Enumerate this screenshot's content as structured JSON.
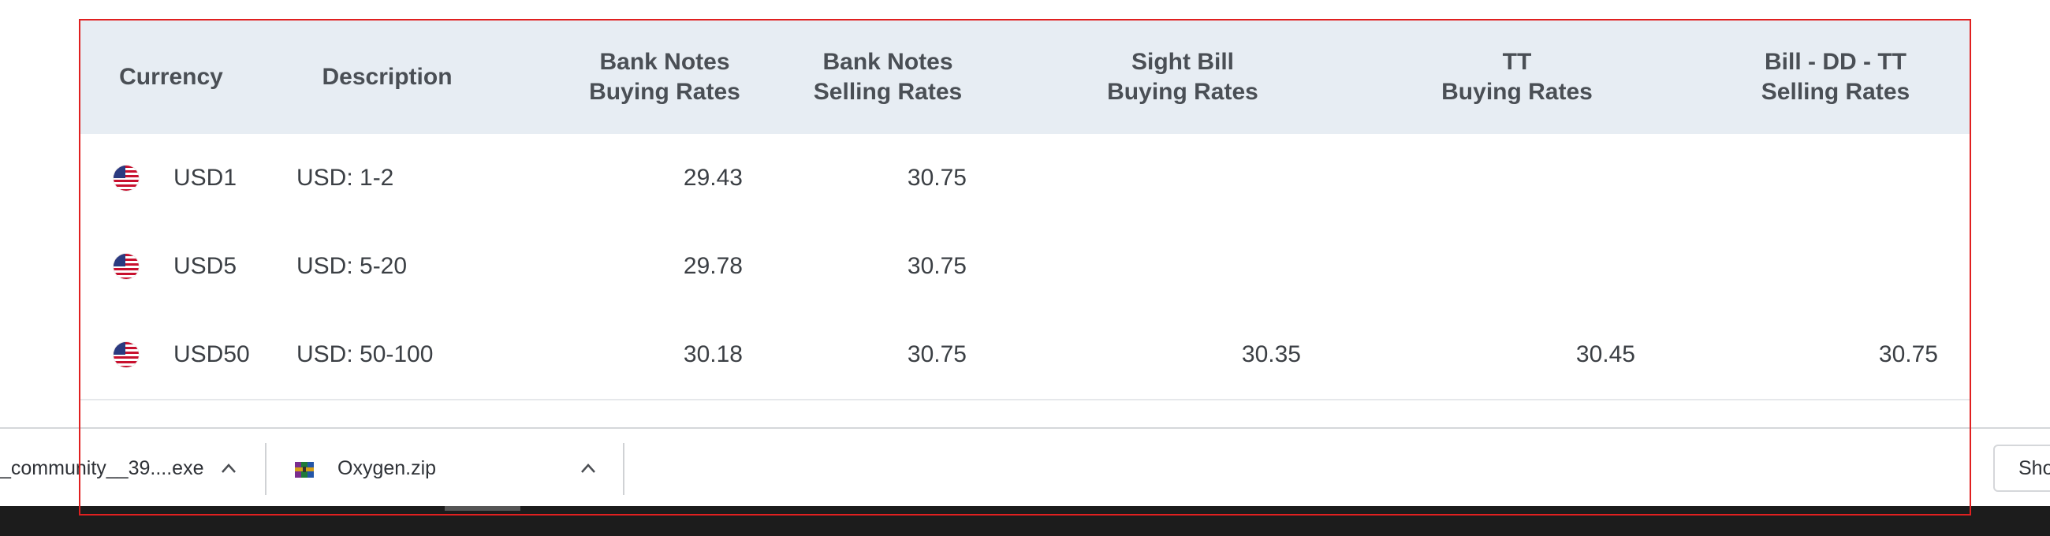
{
  "table": {
    "headers": {
      "currency": "Currency",
      "description": "Description",
      "bank_notes_buying": "Bank Notes\nBuying Rates",
      "bank_notes_selling": "Bank Notes\nSelling Rates",
      "sight_bill_buying": "Sight Bill\nBuying Rates",
      "tt_buying": "TT\nBuying Rates",
      "bill_dd_tt_selling": "Bill - DD - TT\nSelling Rates"
    },
    "rows": [
      {
        "flag_icon": "us-flag-icon",
        "currency": "USD1",
        "description": "USD: 1-2",
        "bank_notes_buying": "29.43",
        "bank_notes_selling": "30.75",
        "sight_bill_buying": "",
        "tt_buying": "",
        "bill_dd_tt_selling": ""
      },
      {
        "flag_icon": "us-flag-icon",
        "currency": "USD5",
        "description": "USD: 5-20",
        "bank_notes_buying": "29.78",
        "bank_notes_selling": "30.75",
        "sight_bill_buying": "",
        "tt_buying": "",
        "bill_dd_tt_selling": ""
      },
      {
        "flag_icon": "us-flag-icon",
        "currency": "USD50",
        "description": "USD: 50-100",
        "bank_notes_buying": "30.18",
        "bank_notes_selling": "30.75",
        "sight_bill_buying": "30.35",
        "tt_buying": "30.45",
        "bill_dd_tt_selling": "30.75"
      }
    ]
  },
  "downloads": {
    "items": [
      {
        "filename": "_community__39....exe",
        "icon": "exe-file-icon"
      },
      {
        "filename": "Oxygen.zip",
        "icon": "zip-archive-icon"
      }
    ],
    "show_all_label": "Sho"
  },
  "colors": {
    "header_bg": "#e7edf3",
    "highlight": "#e02020",
    "taskbar": "#1c1c1c"
  }
}
